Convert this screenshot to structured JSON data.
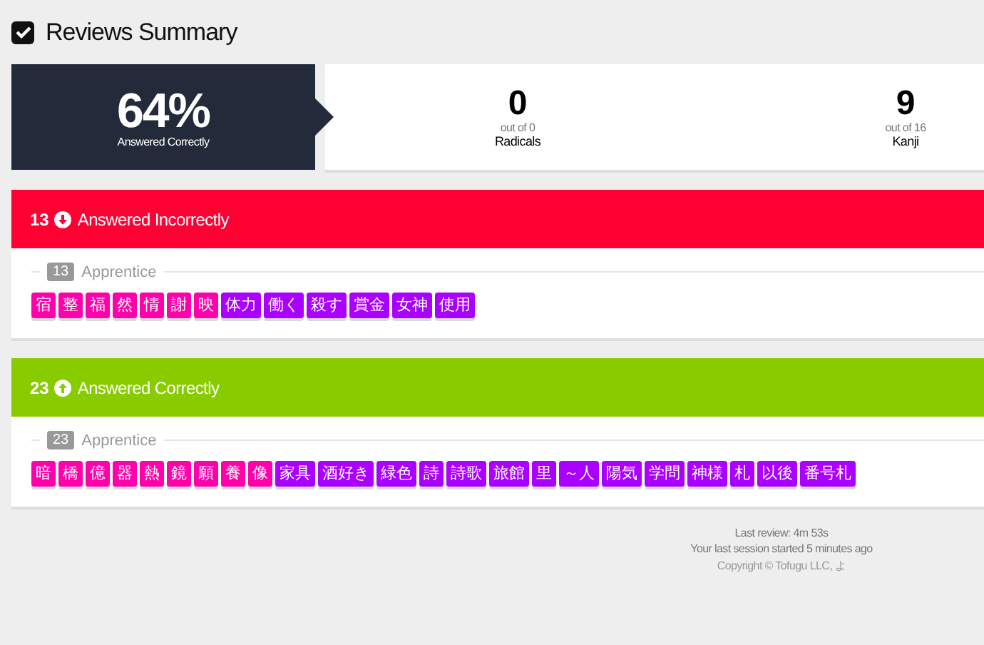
{
  "header": {
    "title": "Reviews Summary",
    "checked": true
  },
  "summary": {
    "percent": "64%",
    "percent_label": "Answered Correctly",
    "stats": [
      {
        "value": "0",
        "out_of": "out of 0",
        "label": "Radicals"
      },
      {
        "value": "9",
        "out_of": "out of 16",
        "label": "Kanji"
      }
    ]
  },
  "sections": [
    {
      "kind": "incorrect",
      "count": "13",
      "title": "Answered Incorrectly",
      "color": "#ff0033",
      "groups": [
        {
          "count": "13",
          "label": "Apprentice",
          "items": [
            {
              "text": "宿",
              "kind": "kanji"
            },
            {
              "text": "整",
              "kind": "kanji"
            },
            {
              "text": "福",
              "kind": "kanji"
            },
            {
              "text": "然",
              "kind": "kanji"
            },
            {
              "text": "情",
              "kind": "kanji"
            },
            {
              "text": "謝",
              "kind": "kanji"
            },
            {
              "text": "映",
              "kind": "kanji"
            },
            {
              "text": "体力",
              "kind": "vocabulary"
            },
            {
              "text": "働く",
              "kind": "vocabulary"
            },
            {
              "text": "殺す",
              "kind": "vocabulary"
            },
            {
              "text": "賞金",
              "kind": "vocabulary"
            },
            {
              "text": "女神",
              "kind": "vocabulary"
            },
            {
              "text": "使用",
              "kind": "vocabulary"
            }
          ]
        }
      ]
    },
    {
      "kind": "correct",
      "count": "23",
      "title": "Answered Correctly",
      "color": "#88cc00",
      "groups": [
        {
          "count": "23",
          "label": "Apprentice",
          "items": [
            {
              "text": "暗",
              "kind": "kanji"
            },
            {
              "text": "橋",
              "kind": "kanji"
            },
            {
              "text": "億",
              "kind": "kanji"
            },
            {
              "text": "器",
              "kind": "kanji"
            },
            {
              "text": "熱",
              "kind": "kanji"
            },
            {
              "text": "鏡",
              "kind": "kanji"
            },
            {
              "text": "願",
              "kind": "kanji"
            },
            {
              "text": "養",
              "kind": "kanji"
            },
            {
              "text": "像",
              "kind": "kanji"
            },
            {
              "text": "家具",
              "kind": "vocabulary"
            },
            {
              "text": "酒好き",
              "kind": "vocabulary"
            },
            {
              "text": "緑色",
              "kind": "vocabulary"
            },
            {
              "text": "詩",
              "kind": "vocabulary"
            },
            {
              "text": "詩歌",
              "kind": "vocabulary"
            },
            {
              "text": "旅館",
              "kind": "vocabulary"
            },
            {
              "text": "里",
              "kind": "vocabulary"
            },
            {
              "text": "～人",
              "kind": "vocabulary"
            },
            {
              "text": "陽気",
              "kind": "vocabulary"
            },
            {
              "text": "学問",
              "kind": "vocabulary"
            },
            {
              "text": "神様",
              "kind": "vocabulary"
            },
            {
              "text": "札",
              "kind": "vocabulary"
            },
            {
              "text": "以後",
              "kind": "vocabulary"
            },
            {
              "text": "番号札",
              "kind": "vocabulary"
            }
          ]
        }
      ]
    }
  ],
  "footer": {
    "last_review": "Last review: 4m 53s",
    "session": "Your last session started 5 minutes ago",
    "copyright": "Copyright © Tofugu LLC, よ"
  }
}
